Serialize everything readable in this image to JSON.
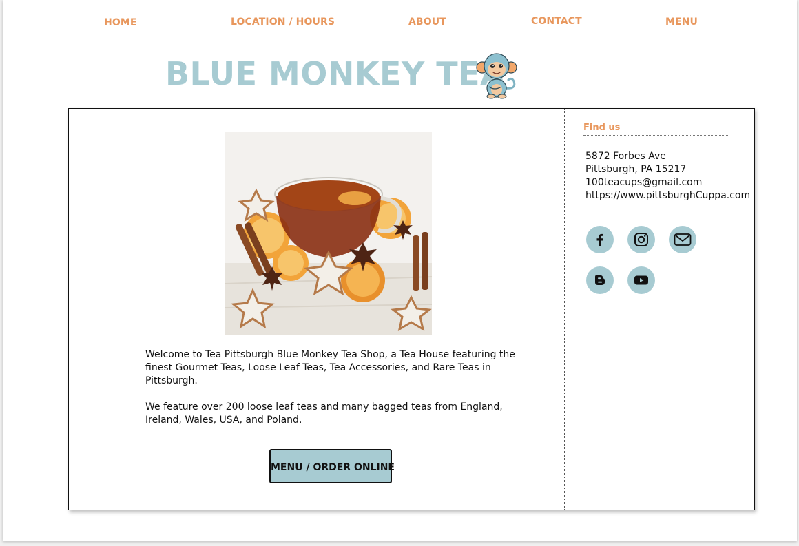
{
  "nav": {
    "home": "HOME",
    "location_hours": "LOCATION / HOURS",
    "about": "ABOUT",
    "contact": "CONTACT",
    "menu": "MENU"
  },
  "brand": {
    "title": "BLUE MONKEY TEA",
    "logo_icon": "monkey-mascot-icon"
  },
  "main": {
    "image_icon": "tea-cup-photo",
    "intro_paragraphs": [
      "Welcome to Tea Pittsburgh Blue Monkey Tea Shop, a Tea House featuring the finest Gourmet Teas, Loose Leaf Teas, Tea Accessories, and Rare Teas in Pittsburgh.",
      "We feature over 200 loose leaf teas and many bagged teas from England, Ireland, Wales, USA, and Poland."
    ],
    "order_button": "MENU / ORDER ONLINE"
  },
  "sidebar": {
    "heading": "Find us",
    "address_lines": [
      "5872 Forbes Ave",
      "Pittsburgh, PA 15217",
      "100teacups@gmail.com",
      "https://www.pittsburghCuppa.com"
    ],
    "social_icons": [
      "facebook-icon",
      "instagram-icon",
      "email-icon",
      "blogger-icon",
      "youtube-icon"
    ]
  },
  "colors": {
    "accent": "#e8975d",
    "brand_blue": "#a7cbd2",
    "text": "#111111"
  }
}
